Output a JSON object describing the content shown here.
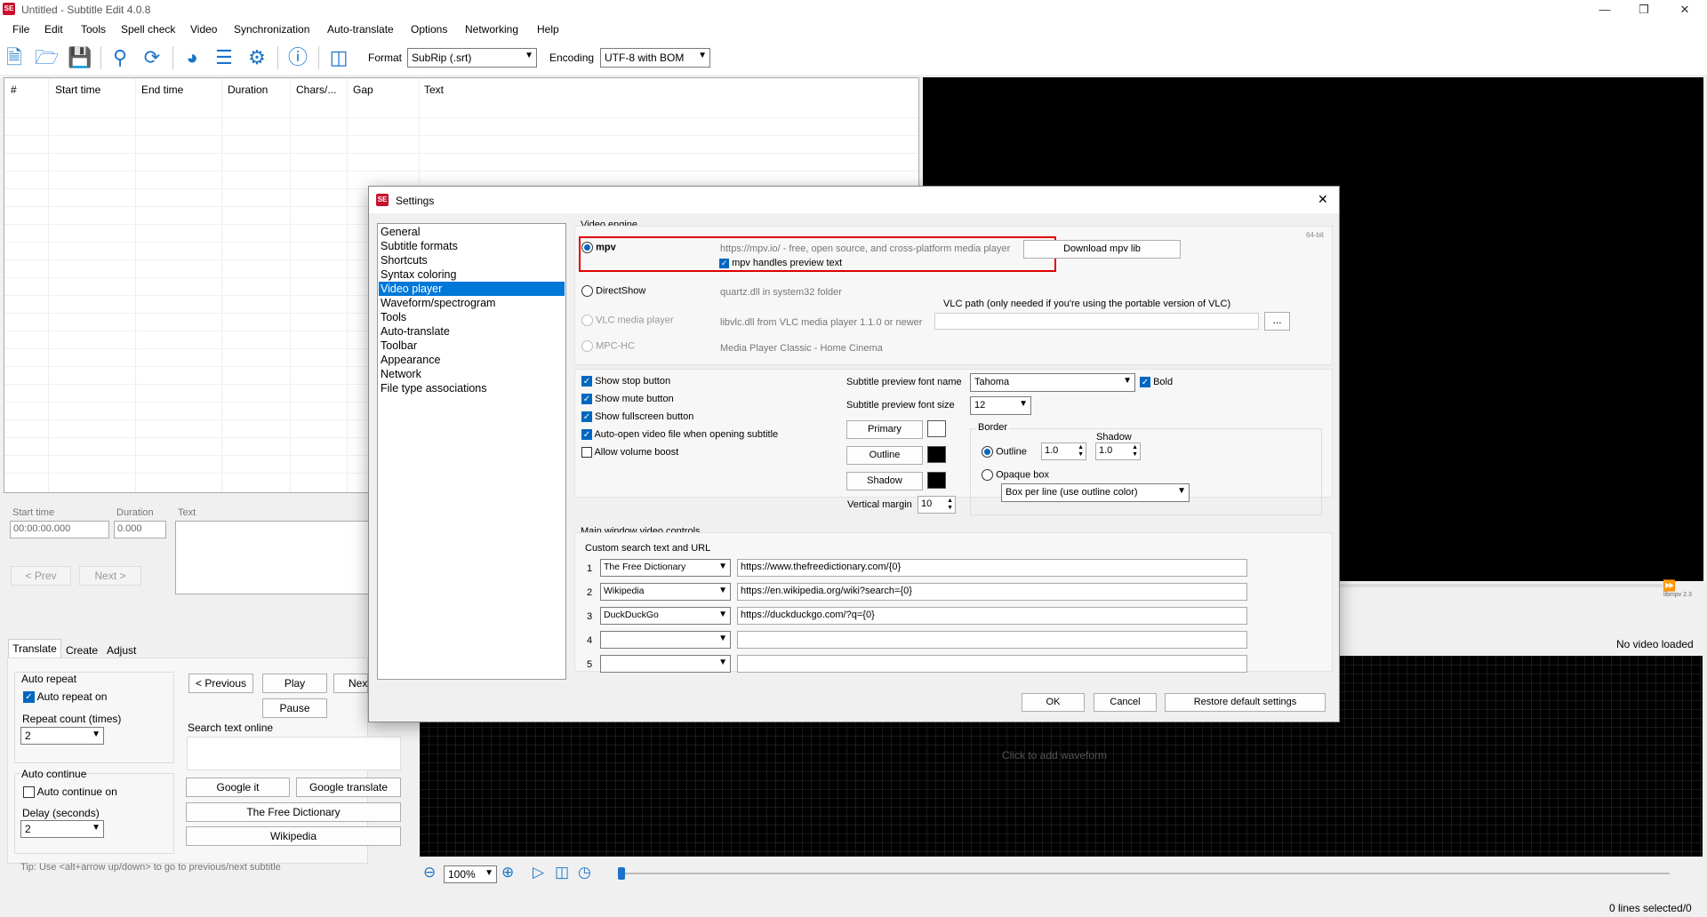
{
  "window": {
    "title": "Untitled - Subtitle Edit 4.0.8",
    "logo": "SE",
    "controls": [
      "minimize-icon",
      "maximize-icon",
      "close-icon"
    ]
  },
  "menu": [
    "File",
    "Edit",
    "Tools",
    "Spell check",
    "Video",
    "Synchronization",
    "Auto-translate",
    "Options",
    "Networking",
    "Help"
  ],
  "toolbar": {
    "format_label": "Format",
    "format_value": "SubRip (.srt)",
    "encoding_label": "Encoding",
    "encoding_value": "UTF-8 with BOM"
  },
  "grid": {
    "columns": [
      "#",
      "Start time",
      "End time",
      "Duration",
      "Chars/...",
      "Gap",
      "Text"
    ]
  },
  "edit": {
    "start_time_label": "Start time",
    "start_time_value": "00:00:00.000",
    "duration_label": "Duration",
    "duration_value": "0.000",
    "text_label": "Text",
    "prev_button": "< Prev",
    "next_button": "Next >"
  },
  "tabs": [
    "Translate",
    "Create",
    "Adjust"
  ],
  "translate": {
    "auto_repeat_title": "Auto repeat",
    "auto_repeat_on": "Auto repeat on",
    "repeat_count_label": "Repeat count (times)",
    "repeat_count_value": "2",
    "auto_continue_title": "Auto continue",
    "auto_continue_on": "Auto continue on",
    "delay_label": "Delay (seconds)",
    "delay_value": "2",
    "previous_button": "< Previous",
    "play_button": "Play",
    "next_button": "Next",
    "pause_button": "Pause",
    "search_online_label": "Search text online",
    "google_it": "Google it",
    "google_translate": "Google translate",
    "free_dictionary": "The Free Dictionary",
    "wikipedia": "Wikipedia",
    "tip": "Tip: Use <alt+arrow up/down> to go to previous/next subtitle"
  },
  "video": {
    "no_video": "No video loaded",
    "libmpv": "libmpv 2.3",
    "waveform_hint": "Click to add waveform",
    "zoom_value": "100%"
  },
  "status": {
    "lines_selected": "0 lines selected/0"
  },
  "dialog": {
    "title": "Settings",
    "logo": "SE",
    "nav": [
      "General",
      "Subtitle formats",
      "Shortcuts",
      "Syntax coloring",
      "Video player",
      "Waveform/spectrogram",
      "Tools",
      "Auto-translate",
      "Toolbar",
      "Appearance",
      "Network",
      "File type associations"
    ],
    "nav_selected": 4,
    "video_engine": {
      "title": "Video engine",
      "bitness": "64-bit",
      "mpv_label": "mpv",
      "mpv_desc": "https://mpv.io/ - free, open source, and cross-platform media player",
      "download_mpv": "Download mpv lib",
      "mpv_preview": "mpv handles preview text",
      "directshow_label": "DirectShow",
      "directshow_desc": "quartz.dll in system32 folder",
      "vlc_label": "VLC media player",
      "vlc_desc": "libvlc.dll from VLC media player 1.1.0 or newer",
      "vlc_path_label": "VLC path (only needed if you're using the portable version of VLC)",
      "vlc_browse": "...",
      "mpchc_label": "MPC-HC",
      "mpchc_desc": "Media Player Classic - Home Cinema"
    },
    "options": {
      "show_stop": "Show stop button",
      "show_mute": "Show mute button",
      "show_fullscreen": "Show fullscreen button",
      "auto_open": "Auto-open video file when opening subtitle",
      "volume_boost": "Allow volume boost",
      "font_name_label": "Subtitle preview font name",
      "font_name_value": "Tahoma",
      "bold_label": "Bold",
      "font_size_label": "Subtitle preview font size",
      "font_size_value": "12",
      "primary_button": "Primary",
      "outline_button": "Outline",
      "shadow_button": "Shadow",
      "vertical_margin_label": "Vertical margin",
      "vertical_margin_value": "10",
      "primary_color": "#ffffff",
      "outline_color": "#000000",
      "shadow_color": "#000000",
      "border_title": "Border",
      "border_outline_label": "Outline",
      "border_outline_value": "1.0",
      "border_shadow_label": "Shadow",
      "border_shadow_value": "1.0",
      "opaque_box_label": "Opaque box",
      "box_mode_value": "Box per line (use outline color)"
    },
    "controls": {
      "title": "Main window video controls",
      "custom_search_label": "Custom search text and URL",
      "rows": [
        {
          "num": "1",
          "name": "The Free Dictionary",
          "url": "https://www.thefreedictionary.com/{0}"
        },
        {
          "num": "2",
          "name": "Wikipedia",
          "url": "https://en.wikipedia.org/wiki?search={0}"
        },
        {
          "num": "3",
          "name": "DuckDuckGo",
          "url": "https://duckduckgo.com/?q={0}"
        },
        {
          "num": "4",
          "name": "",
          "url": ""
        },
        {
          "num": "5",
          "name": "",
          "url": ""
        }
      ]
    },
    "ok": "OK",
    "cancel": "Cancel",
    "restore": "Restore default settings"
  },
  "colors": {
    "accent": "#0078d7",
    "highlight": "#e00000",
    "toolbar_icon": "#1a73c9"
  }
}
